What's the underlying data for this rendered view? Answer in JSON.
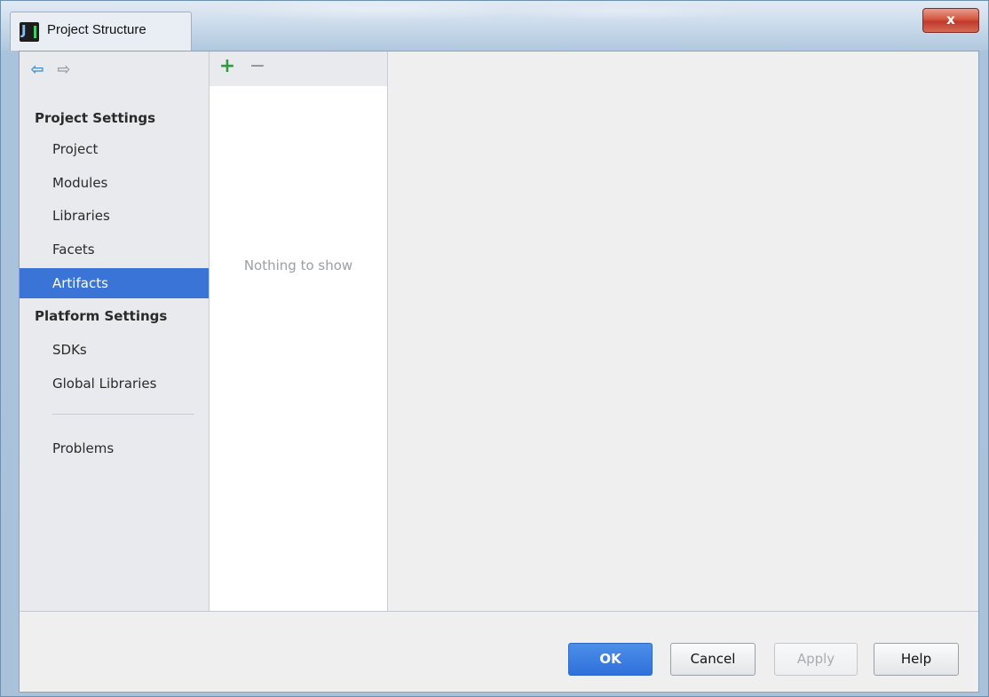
{
  "window": {
    "title": "Project Structure",
    "close_label": "x"
  },
  "toolbar": {
    "back_icon": "left-arrow",
    "forward_icon": "right-arrow",
    "back_glyph": "⇦",
    "forward_glyph": "⇨"
  },
  "sidebar": {
    "project_settings_heading": "Project Settings",
    "project_items": [
      {
        "label": "Project",
        "selected": false
      },
      {
        "label": "Modules",
        "selected": false
      },
      {
        "label": "Libraries",
        "selected": false
      },
      {
        "label": "Facets",
        "selected": false
      },
      {
        "label": "Artifacts",
        "selected": true
      }
    ],
    "platform_settings_heading": "Platform Settings",
    "platform_items": [
      {
        "label": "SDKs",
        "selected": false
      },
      {
        "label": "Global Libraries",
        "selected": false
      }
    ],
    "problems_label": "Problems"
  },
  "list_panel": {
    "add_glyph": "+",
    "remove_glyph": "−",
    "empty_text": "Nothing to show"
  },
  "footer": {
    "ok_label": "OK",
    "cancel_label": "Cancel",
    "apply_label": "Apply",
    "help_label": "Help"
  },
  "colors": {
    "selection": "#3a74d6",
    "ok_button": "#2f70db",
    "add_icon": "#2e9d3a",
    "close_button": "#c0392b"
  }
}
